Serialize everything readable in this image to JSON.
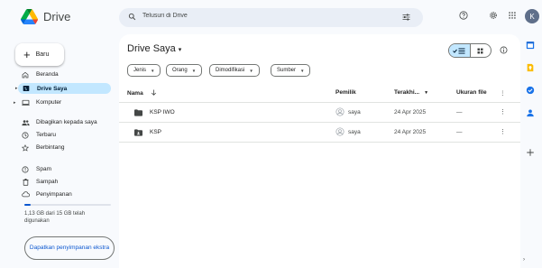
{
  "app": {
    "name": "Drive"
  },
  "search": {
    "placeholder": "Telusuri di Drive"
  },
  "header": {
    "avatar_letter": "K"
  },
  "sidebar": {
    "new_label": "Baru",
    "items": [
      {
        "label": "Beranda",
        "icon": "home-icon"
      },
      {
        "label": "Drive Saya",
        "icon": "my-drive-icon",
        "active": true
      },
      {
        "label": "Komputer",
        "icon": "computer-icon"
      },
      {
        "label": "Dibagikan kepada saya",
        "icon": "shared-icon"
      },
      {
        "label": "Terbaru",
        "icon": "clock-icon"
      },
      {
        "label": "Berbintang",
        "icon": "star-icon"
      },
      {
        "label": "Spam",
        "icon": "spam-icon"
      },
      {
        "label": "Sampah",
        "icon": "trash-icon"
      },
      {
        "label": "Penyimpanan",
        "icon": "cloud-icon"
      }
    ],
    "storage_fraction": 0.076,
    "storage_text": "1,13 GB dari 15 GB telah digunakan",
    "get_storage_label": "Dapatkan penyimpanan ekstra"
  },
  "main": {
    "title": "Drive Saya",
    "filters": [
      "Jenis",
      "Orang",
      "Dimodifikasi",
      "Sumber"
    ],
    "columns": {
      "name": "Nama",
      "owner": "Pemilik",
      "modified": "Terakhi...",
      "size": "Ukuran file"
    },
    "rows": [
      {
        "name": "KSP IWO",
        "owner": "saya",
        "modified": "24 Apr 2025",
        "size": "—"
      },
      {
        "name": "KSP",
        "owner": "saya",
        "modified": "24 Apr 2025",
        "size": "—"
      }
    ]
  },
  "colors": {
    "accent": "#0b57d0",
    "active_bg": "#c2e7ff",
    "search_bg": "#e9eef6",
    "page_bg": "#f8fafd"
  }
}
